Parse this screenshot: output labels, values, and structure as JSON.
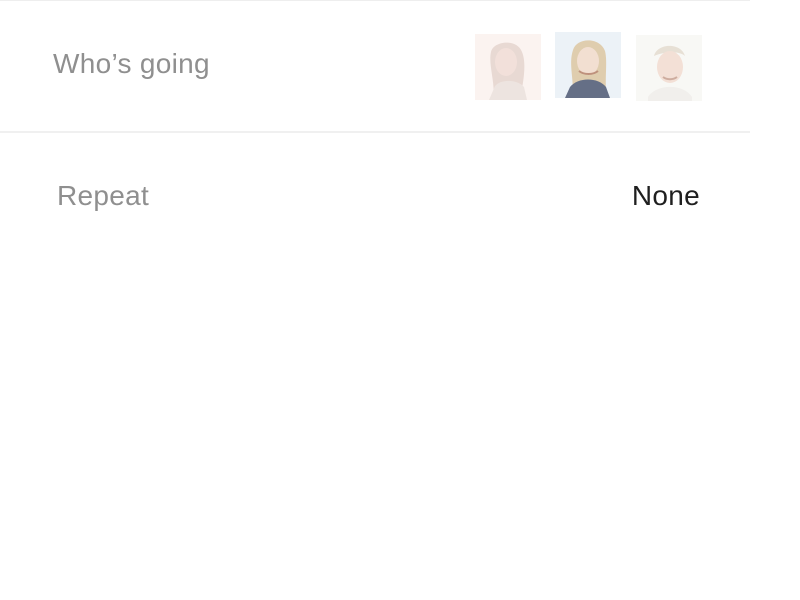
{
  "event_details": {
    "whos_going": {
      "label": "Who’s going",
      "attendees": [
        {
          "icon": "attendee-avatar-1"
        },
        {
          "icon": "attendee-avatar-2"
        },
        {
          "icon": "attendee-avatar-3"
        }
      ]
    },
    "repeat": {
      "label": "Repeat",
      "value": "None"
    }
  },
  "colors": {
    "background": "#ffffff",
    "label": "#8f8f8f",
    "value": "#1f1f1f",
    "divider": "#f0f0f0"
  }
}
